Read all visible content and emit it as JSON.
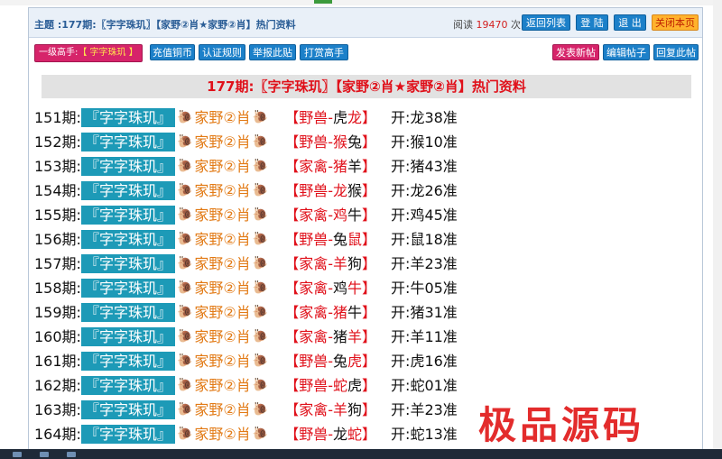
{
  "header": {
    "title": "主题 :177期:〖字字珠玑〗【家野②肖★家野②肖】热门资料",
    "read_label": "阅读",
    "read_count": "19470",
    "read_unit": "次",
    "buttons": [
      "返回列表",
      "登 陆",
      "退 出",
      "关闭本页"
    ]
  },
  "toolbar": {
    "level_label": "一级高手:",
    "level_value": "【 字字珠玑 】",
    "left_buttons": [
      "充值铜币",
      "认证规则",
      "举报此贴",
      "打赏高手"
    ],
    "right_buttons": [
      "发表新帖",
      "编辑帖子",
      "回复此帖"
    ]
  },
  "banner": "177期:〖字字珠玑〗【家野②肖★家野②肖】热门资料",
  "entries": [
    {
      "period": "151期:",
      "tag": "『字字珠玑』",
      "mid": "家野②肖",
      "cat": "野兽",
      "a": "虎",
      "b": "龙",
      "red": "b",
      "open": "开:龙38准"
    },
    {
      "period": "152期:",
      "tag": "『字字珠玑』",
      "mid": "家野②肖",
      "cat": "野兽",
      "a": "猴",
      "b": "兔",
      "red": "a",
      "open": "开:猴10准"
    },
    {
      "period": "153期:",
      "tag": "『字字珠玑』",
      "mid": "家野②肖",
      "cat": "家禽",
      "a": "猪",
      "b": "羊",
      "red": "a",
      "open": "开:猪43准"
    },
    {
      "period": "154期:",
      "tag": "『字字珠玑』",
      "mid": "家野②肖",
      "cat": "野兽",
      "a": "龙",
      "b": "猴",
      "red": "a",
      "open": "开:龙26准"
    },
    {
      "period": "155期:",
      "tag": "『字字珠玑』",
      "mid": "家野②肖",
      "cat": "家禽",
      "a": "鸡",
      "b": "牛",
      "red": "a",
      "open": "开:鸡45准"
    },
    {
      "period": "156期:",
      "tag": "『字字珠玑』",
      "mid": "家野②肖",
      "cat": "野兽",
      "a": "兔",
      "b": "鼠",
      "red": "b",
      "open": "开:鼠18准"
    },
    {
      "period": "157期:",
      "tag": "『字字珠玑』",
      "mid": "家野②肖",
      "cat": "家禽",
      "a": "羊",
      "b": "狗",
      "red": "a",
      "open": "开:羊23准"
    },
    {
      "period": "158期:",
      "tag": "『字字珠玑』",
      "mid": "家野②肖",
      "cat": "家禽",
      "a": "鸡",
      "b": "牛",
      "red": "b",
      "open": "开:牛05准"
    },
    {
      "period": "159期:",
      "tag": "『字字珠玑』",
      "mid": "家野②肖",
      "cat": "家禽",
      "a": "猪",
      "b": "牛",
      "red": "a",
      "open": "开:猪31准"
    },
    {
      "period": "160期:",
      "tag": "『字字珠玑』",
      "mid": "家野②肖",
      "cat": "家禽",
      "a": "猪",
      "b": "羊",
      "red": "b",
      "open": "开:羊11准"
    },
    {
      "period": "161期:",
      "tag": "『字字珠玑』",
      "mid": "家野②肖",
      "cat": "野兽",
      "a": "兔",
      "b": "虎",
      "red": "b",
      "open": "开:虎16准"
    },
    {
      "period": "162期:",
      "tag": "『字字珠玑』",
      "mid": "家野②肖",
      "cat": "野兽",
      "a": "蛇",
      "b": "虎",
      "red": "a",
      "open": "开:蛇01准"
    },
    {
      "period": "163期:",
      "tag": "『字字珠玑』",
      "mid": "家野②肖",
      "cat": "家禽",
      "a": "羊",
      "b": "狗",
      "red": "a",
      "open": "开:羊23准"
    },
    {
      "period": "164期:",
      "tag": "『字字珠玑』",
      "mid": "家野②肖",
      "cat": "野兽",
      "a": "龙",
      "b": "蛇",
      "red": "b",
      "open": "开:蛇13准"
    }
  ],
  "snail_icon": "snail-icon",
  "watermark": "极品源码",
  "colors": {
    "accent_red": "#e0101a",
    "tag_blue": "#1d9ab7",
    "orange_text": "#e27a15",
    "pink_button": "#d6246a",
    "blue_button": "#1c80c9"
  }
}
